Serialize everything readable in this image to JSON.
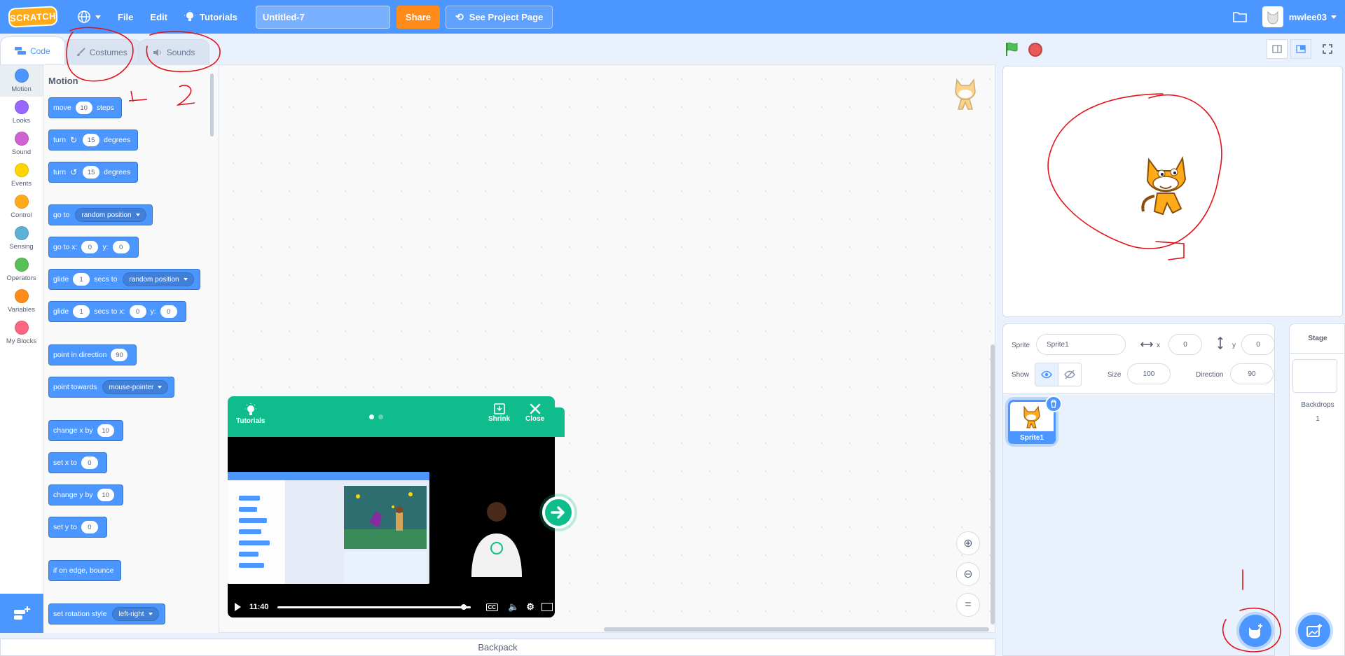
{
  "menubar": {
    "logo": "SCRATCH",
    "file": "File",
    "edit": "Edit",
    "tutorials": "Tutorials",
    "project_title": "Untitled-7",
    "share": "Share",
    "see_project": "See Project Page",
    "username": "mwlee03"
  },
  "tabs": {
    "code": "Code",
    "costumes": "Costumes",
    "sounds": "Sounds"
  },
  "categories": [
    {
      "label": "Motion",
      "color": "#4c97ff"
    },
    {
      "label": "Looks",
      "color": "#9966ff"
    },
    {
      "label": "Sound",
      "color": "#cf63cf"
    },
    {
      "label": "Events",
      "color": "#ffd500"
    },
    {
      "label": "Control",
      "color": "#ffab19"
    },
    {
      "label": "Sensing",
      "color": "#5cb1d6"
    },
    {
      "label": "Operators",
      "color": "#59c059"
    },
    {
      "label": "Variables",
      "color": "#ff8c1a"
    },
    {
      "label": "My Blocks",
      "color": "#ff6680"
    }
  ],
  "palette": {
    "section": "Motion",
    "blocks": {
      "move": {
        "a": "move",
        "v1": "10",
        "b": "steps"
      },
      "turn_right": {
        "a": "turn",
        "icon": "↻",
        "v1": "15",
        "b": "degrees"
      },
      "turn_left": {
        "a": "turn",
        "icon": "↺",
        "v1": "15",
        "b": "degrees"
      },
      "goto": {
        "a": "go to",
        "d1": "random position"
      },
      "goto_xy": {
        "a": "go to x:",
        "v1": "0",
        "b": "y:",
        "v2": "0"
      },
      "glide_to": {
        "a": "glide",
        "v1": "1",
        "b": "secs to",
        "d1": "random position"
      },
      "glide_xy": {
        "a": "glide",
        "v1": "1",
        "b": "secs to x:",
        "v2": "0",
        "c": "y:",
        "v3": "0"
      },
      "point_dir": {
        "a": "point in direction",
        "v1": "90"
      },
      "point_towards": {
        "a": "point towards",
        "d1": "mouse-pointer"
      },
      "change_x": {
        "a": "change x by",
        "v1": "10"
      },
      "set_x": {
        "a": "set x to",
        "v1": "0"
      },
      "change_y": {
        "a": "change y by",
        "v1": "10"
      },
      "set_y": {
        "a": "set y to",
        "v1": "0"
      },
      "bounce": {
        "a": "if on edge, bounce"
      },
      "rotation": {
        "a": "set rotation style",
        "d1": "left-right"
      }
    }
  },
  "tutorial_card": {
    "tutorials": "Tutorials",
    "shrink": "Shrink",
    "close": "Close",
    "time": "11:40",
    "playback_fraction": 0.97
  },
  "backpack": "Backpack",
  "sprite_info": {
    "sprite_label": "Sprite",
    "sprite_name": "Sprite1",
    "x_label": "x",
    "x_value": "0",
    "y_label": "y",
    "y_value": "0",
    "show_label": "Show",
    "size_label": "Size",
    "size_value": "100",
    "direction_label": "Direction",
    "direction_value": "90"
  },
  "sprites": [
    {
      "name": "Sprite1"
    }
  ],
  "stage_pane": {
    "title": "Stage",
    "backdrops_label": "Backdrops",
    "backdrops_count": "1"
  },
  "annotation": {
    "color": "#e0141e",
    "marks": [
      "1",
      "2"
    ]
  }
}
